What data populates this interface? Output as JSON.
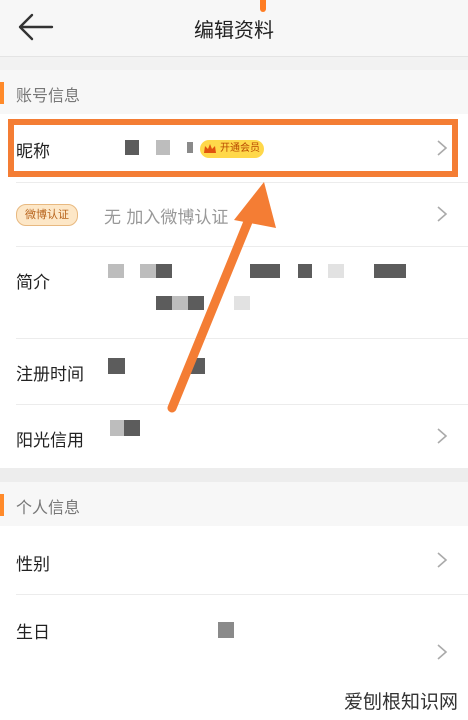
{
  "header": {
    "title": "编辑资料",
    "back_icon": "arrow-left-icon"
  },
  "sections": {
    "account": {
      "title": "账号信息",
      "nickname_label": "昵称",
      "vip_badge": "开通会员",
      "weibo_badge": "微博认证",
      "weibo_value": "无 加入微博认证",
      "intro_label": "简介",
      "register_label": "注册时间",
      "sunshine_label": "阳光信用"
    },
    "personal": {
      "title": "个人信息",
      "gender_label": "性别",
      "birthday_label": "生日"
    }
  },
  "watermark": "爱刨根知识网",
  "colors": {
    "accent": "#ff8a2a",
    "highlight": "#f47d34",
    "vip": "#ffd84a"
  }
}
